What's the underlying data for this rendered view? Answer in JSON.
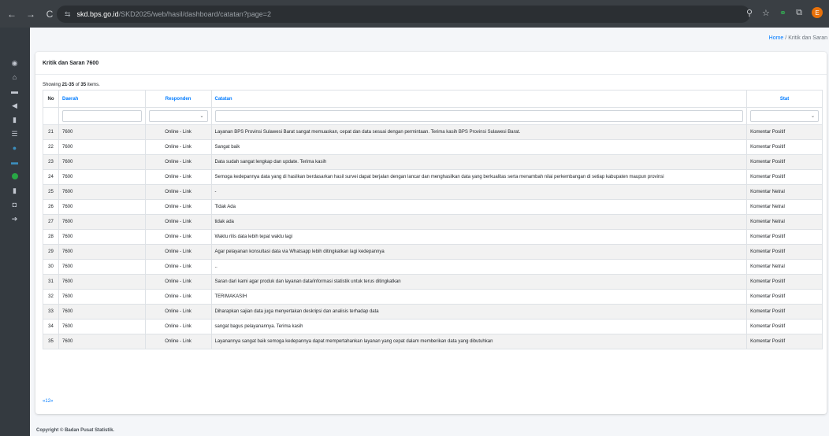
{
  "browser": {
    "back": "←",
    "forward": "→",
    "reload": "C",
    "tune_icon": "⇆",
    "url_host": "skd.bps.go.id",
    "url_path": "/SKD2025/web/hasil/dashboard/catatan?page=2",
    "zoom_icon": "⚲",
    "star_icon": "☆",
    "profile_initial": "E"
  },
  "breadcrumb": {
    "home": "Home",
    "separator": " / ",
    "current": "Kritik dan Saran"
  },
  "card": {
    "title": "Kritik dan Saran 7600"
  },
  "summary": {
    "prefix": "Showing ",
    "range": "21-35",
    "middle": " of ",
    "total": "35",
    "suffix": " items."
  },
  "table": {
    "headers": {
      "no": "No",
      "daerah": "Daerah",
      "responden": "Responden",
      "catatan": "Catatan",
      "stat": "Stat"
    },
    "rows": [
      {
        "no": "21",
        "daerah": "7600",
        "responden": "Online - Link",
        "catatan": "Layanan BPS Provinsi Sulawesi Barat sangat memuaskan, cepat dan data sesuai dengan permintaan. Terima kasih BPS Provinsi Sulawesi Barat.",
        "stat": "Komentar Positif"
      },
      {
        "no": "22",
        "daerah": "7600",
        "responden": "Online - Link",
        "catatan": "Sangat baik",
        "stat": "Komentar Positif"
      },
      {
        "no": "23",
        "daerah": "7600",
        "responden": "Online - Link",
        "catatan": "Data sudah sangat lengkap dan update. Terima kasih",
        "stat": "Komentar Positif"
      },
      {
        "no": "24",
        "daerah": "7600",
        "responden": "Online - Link",
        "catatan": "Semoga kedepannya data yang di hasilkan berdasarkan hasil survei dapat berjalan dengan lancar dan menghasilkan data yang berkualitas serta menambah nilai perkembangan di setiap kabupaten maupun provinsi",
        "stat": "Komentar Positif"
      },
      {
        "no": "25",
        "daerah": "7600",
        "responden": "Online - Link",
        "catatan": "-",
        "stat": "Komentar Netral"
      },
      {
        "no": "26",
        "daerah": "7600",
        "responden": "Online - Link",
        "catatan": "Tidak Ada",
        "stat": "Komentar Netral"
      },
      {
        "no": "27",
        "daerah": "7600",
        "responden": "Online - Link",
        "catatan": "tidak ada",
        "stat": "Komentar Netral"
      },
      {
        "no": "28",
        "daerah": "7600",
        "responden": "Online - Link",
        "catatan": "Waktu rilis data lebih tepat waktu lagi",
        "stat": "Komentar Positif"
      },
      {
        "no": "29",
        "daerah": "7600",
        "responden": "Online - Link",
        "catatan": "Agar pelayanan konsultasi data via Whatsapp lebih ditingkatkan lagi kedepannya",
        "stat": "Komentar Positif"
      },
      {
        "no": "30",
        "daerah": "7600",
        "responden": "Online - Link",
        "catatan": "..",
        "stat": "Komentar Netral"
      },
      {
        "no": "31",
        "daerah": "7600",
        "responden": "Online - Link",
        "catatan": "Saran dari kami agar produk dan layanan data/informasi statistik untuk terus ditingkatkan",
        "stat": "Komentar Positif"
      },
      {
        "no": "32",
        "daerah": "7600",
        "responden": "Online - Link",
        "catatan": "TERIMAKASIH",
        "stat": "Komentar Positif"
      },
      {
        "no": "33",
        "daerah": "7600",
        "responden": "Online - Link",
        "catatan": "Diharapkan sajian data juga menyertakan deskripsi dan analisis terhadap data",
        "stat": "Komentar Positif"
      },
      {
        "no": "34",
        "daerah": "7600",
        "responden": "Online - Link",
        "catatan": "sangat bagus pelayanannya. Terima kasih",
        "stat": "Komentar Positif"
      },
      {
        "no": "35",
        "daerah": "7600",
        "responden": "Online - Link",
        "catatan": "Layanannya sangat baik semoga kedepannya dapat mempertahankan layanan yang cepat dalam memberikan data yang dibutuhkan",
        "stat": "Komentar Positif"
      }
    ]
  },
  "pagination": {
    "prev": "«",
    "page1": "1",
    "page2": "2",
    "next": "»"
  },
  "footer": {
    "copyright": "Copyright © Badan Pusat Statistik."
  },
  "colors": {
    "accent": "#007bff",
    "sidebar": "#343a40",
    "chrome": "#3a3f44"
  }
}
